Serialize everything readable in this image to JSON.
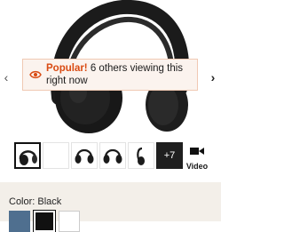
{
  "gallery": {
    "prev_arrow": "‹",
    "next_arrow": "›",
    "banner": {
      "highlight": "Popular!",
      "message": " 6 others viewing this right now",
      "accent_color": "#d94b13"
    },
    "more_count": "+7",
    "video_label": "Video"
  },
  "options": {
    "color_label": "Color: Black",
    "swatches": [
      "#4f6f8f",
      "#111111",
      "#ffffff"
    ]
  }
}
